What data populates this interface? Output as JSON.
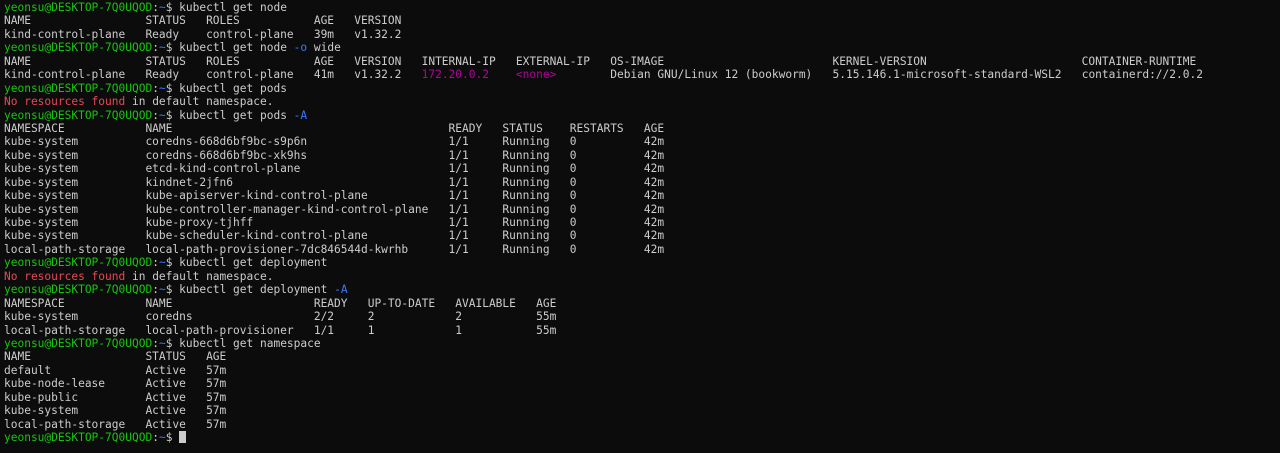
{
  "terminal": {
    "colors": {
      "background": "#0c0c0c",
      "foreground": "#cccccc",
      "user_host": "#16c60c",
      "path": "#3b78ff",
      "error": "#e74856",
      "ip": "#b4009e"
    },
    "lines": [
      [
        {
          "t": "yeonsu@DESKTOP-7Q0UQOD",
          "c": "user"
        },
        {
          "t": ":",
          "c": "text"
        },
        {
          "t": "~",
          "c": "path"
        },
        {
          "t": "$ kubectl get node",
          "c": "text"
        }
      ],
      [
        {
          "t": "NAME                 STATUS   ROLES           AGE   VERSION",
          "c": "text"
        }
      ],
      [
        {
          "t": "kind-control-plane   Ready    control-plane   39m   v1.32.2",
          "c": "text"
        }
      ],
      [
        {
          "t": "yeonsu@DESKTOP-7Q0UQOD",
          "c": "user"
        },
        {
          "t": ":",
          "c": "text"
        },
        {
          "t": "~",
          "c": "path"
        },
        {
          "t": "$ kubectl get node ",
          "c": "text"
        },
        {
          "t": "-o",
          "c": "flag"
        },
        {
          "t": " wide",
          "c": "text"
        }
      ],
      [
        {
          "t": "NAME                 STATUS   ROLES           AGE   VERSION   INTERNAL-IP   EXTERNAL-IP   OS-IMAGE                         KERNEL-VERSION                       CONTAINER-RUNTIME",
          "c": "text"
        }
      ],
      [
        {
          "t": "kind-control-plane   Ready    control-plane   41m   v1.32.2   ",
          "c": "text"
        },
        {
          "t": "172.20.0.2",
          "c": "ip"
        },
        {
          "t": "    ",
          "c": "text"
        },
        {
          "t": "<none>",
          "c": "ip"
        },
        {
          "t": "        Debian GNU/Linux 12 (bookworm)   5.15.146.1-microsoft-standard-WSL2   containerd://2.0.2",
          "c": "text"
        }
      ],
      [
        {
          "t": "yeonsu@DESKTOP-7Q0UQOD",
          "c": "user"
        },
        {
          "t": ":",
          "c": "text"
        },
        {
          "t": "~",
          "c": "path"
        },
        {
          "t": "$ kubectl get pods",
          "c": "text"
        }
      ],
      [
        {
          "t": "No resources found",
          "c": "error"
        },
        {
          "t": " in default namespace.",
          "c": "text"
        }
      ],
      [
        {
          "t": "yeonsu@DESKTOP-7Q0UQOD",
          "c": "user"
        },
        {
          "t": ":",
          "c": "text"
        },
        {
          "t": "~",
          "c": "path"
        },
        {
          "t": "$ kubectl get pods ",
          "c": "text"
        },
        {
          "t": "-A",
          "c": "flag"
        }
      ],
      [
        {
          "t": "NAMESPACE            NAME                                         READY   STATUS    RESTARTS   AGE",
          "c": "text"
        }
      ],
      [
        {
          "t": "kube-system          coredns-668d6bf9bc-s9p6n                     1/1     Running   0          42m",
          "c": "text"
        }
      ],
      [
        {
          "t": "kube-system          coredns-668d6bf9bc-xk9hs                     1/1     Running   0          42m",
          "c": "text"
        }
      ],
      [
        {
          "t": "kube-system          etcd-kind-control-plane                      1/1     Running   0          42m",
          "c": "text"
        }
      ],
      [
        {
          "t": "kube-system          kindnet-2jfn6                                1/1     Running   0          42m",
          "c": "text"
        }
      ],
      [
        {
          "t": "kube-system          kube-apiserver-kind-control-plane            1/1     Running   0          42m",
          "c": "text"
        }
      ],
      [
        {
          "t": "kube-system          kube-controller-manager-kind-control-plane   1/1     Running   0          42m",
          "c": "text"
        }
      ],
      [
        {
          "t": "kube-system          kube-proxy-tjhff                             1/1     Running   0          42m",
          "c": "text"
        }
      ],
      [
        {
          "t": "kube-system          kube-scheduler-kind-control-plane            1/1     Running   0          42m",
          "c": "text"
        }
      ],
      [
        {
          "t": "local-path-storage   local-path-provisioner-7dc846544d-kwrhb      1/1     Running   0          42m",
          "c": "text"
        }
      ],
      [
        {
          "t": "yeonsu@DESKTOP-7Q0UQOD",
          "c": "user"
        },
        {
          "t": ":",
          "c": "text"
        },
        {
          "t": "~",
          "c": "path"
        },
        {
          "t": "$ kubectl get deployment",
          "c": "text"
        }
      ],
      [
        {
          "t": "No resources found",
          "c": "error"
        },
        {
          "t": " in default namespace.",
          "c": "text"
        }
      ],
      [
        {
          "t": "yeonsu@DESKTOP-7Q0UQOD",
          "c": "user"
        },
        {
          "t": ":",
          "c": "text"
        },
        {
          "t": "~",
          "c": "path"
        },
        {
          "t": "$ kubectl get deployment ",
          "c": "text"
        },
        {
          "t": "-A",
          "c": "flag"
        }
      ],
      [
        {
          "t": "NAMESPACE            NAME                     READY   UP-TO-DATE   AVAILABLE   AGE",
          "c": "text"
        }
      ],
      [
        {
          "t": "kube-system          coredns                  2/2     2            2           55m",
          "c": "text"
        }
      ],
      [
        {
          "t": "local-path-storage   local-path-provisioner   1/1     1            1           55m",
          "c": "text"
        }
      ],
      [
        {
          "t": "yeonsu@DESKTOP-7Q0UQOD",
          "c": "user"
        },
        {
          "t": ":",
          "c": "text"
        },
        {
          "t": "~",
          "c": "path"
        },
        {
          "t": "$ kubectl get namespace",
          "c": "text"
        }
      ],
      [
        {
          "t": "NAME                 STATUS   AGE",
          "c": "text"
        }
      ],
      [
        {
          "t": "default              Active   57m",
          "c": "text"
        }
      ],
      [
        {
          "t": "kube-node-lease      Active   57m",
          "c": "text"
        }
      ],
      [
        {
          "t": "kube-public          Active   57m",
          "c": "text"
        }
      ],
      [
        {
          "t": "kube-system          Active   57m",
          "c": "text"
        }
      ],
      [
        {
          "t": "local-path-storage   Active   57m",
          "c": "text"
        }
      ],
      [
        {
          "t": "yeonsu@DESKTOP-7Q0UQOD",
          "c": "user"
        },
        {
          "t": ":",
          "c": "text"
        },
        {
          "t": "~",
          "c": "path"
        },
        {
          "t": "$ ",
          "c": "text"
        }
      ]
    ]
  }
}
